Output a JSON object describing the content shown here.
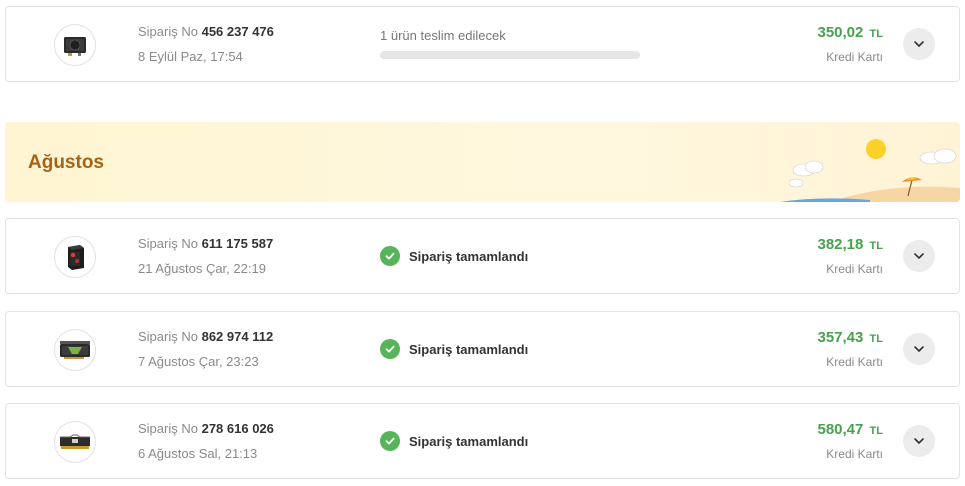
{
  "orders": [
    {
      "label_prefix": "Sipariş No",
      "number": "456 237 476",
      "date": "8 Eylül Paz, 17:54",
      "status_text": "1 ürün teslim edilecek",
      "progress": 0.0,
      "amount": "350,02",
      "currency": "TL",
      "payment": "Kredi Kartı",
      "thumb_icon": "power-supply-icon"
    }
  ],
  "month_section": {
    "title": "Ağustos",
    "orders": [
      {
        "label_prefix": "Sipariş No",
        "number": "611 175 587",
        "date": "21 Ağustos Çar, 22:19",
        "status_text": "Sipariş tamamlandı",
        "amount": "382,18",
        "currency": "TL",
        "payment": "Kredi Kartı",
        "thumb_icon": "pc-case-icon"
      },
      {
        "label_prefix": "Sipariş No",
        "number": "862 974 112",
        "date": "7 Ağustos Çar, 23:23",
        "status_text": "Sipariş tamamlandı",
        "amount": "357,43",
        "currency": "TL",
        "payment": "Kredi Kartı",
        "thumb_icon": "graphics-card-icon"
      },
      {
        "label_prefix": "Sipariş No",
        "number": "278 616 026",
        "date": "6 Ağustos Sal, 21:13",
        "status_text": "Sipariş tamamlandı",
        "amount": "580,47",
        "currency": "TL",
        "payment": "Kredi Kartı",
        "thumb_icon": "ram-module-icon"
      }
    ]
  },
  "colors": {
    "price_green": "#48a14d",
    "check_green": "#56b55b",
    "month_title": "#a76416",
    "banner_bg": "#fff5d2"
  }
}
